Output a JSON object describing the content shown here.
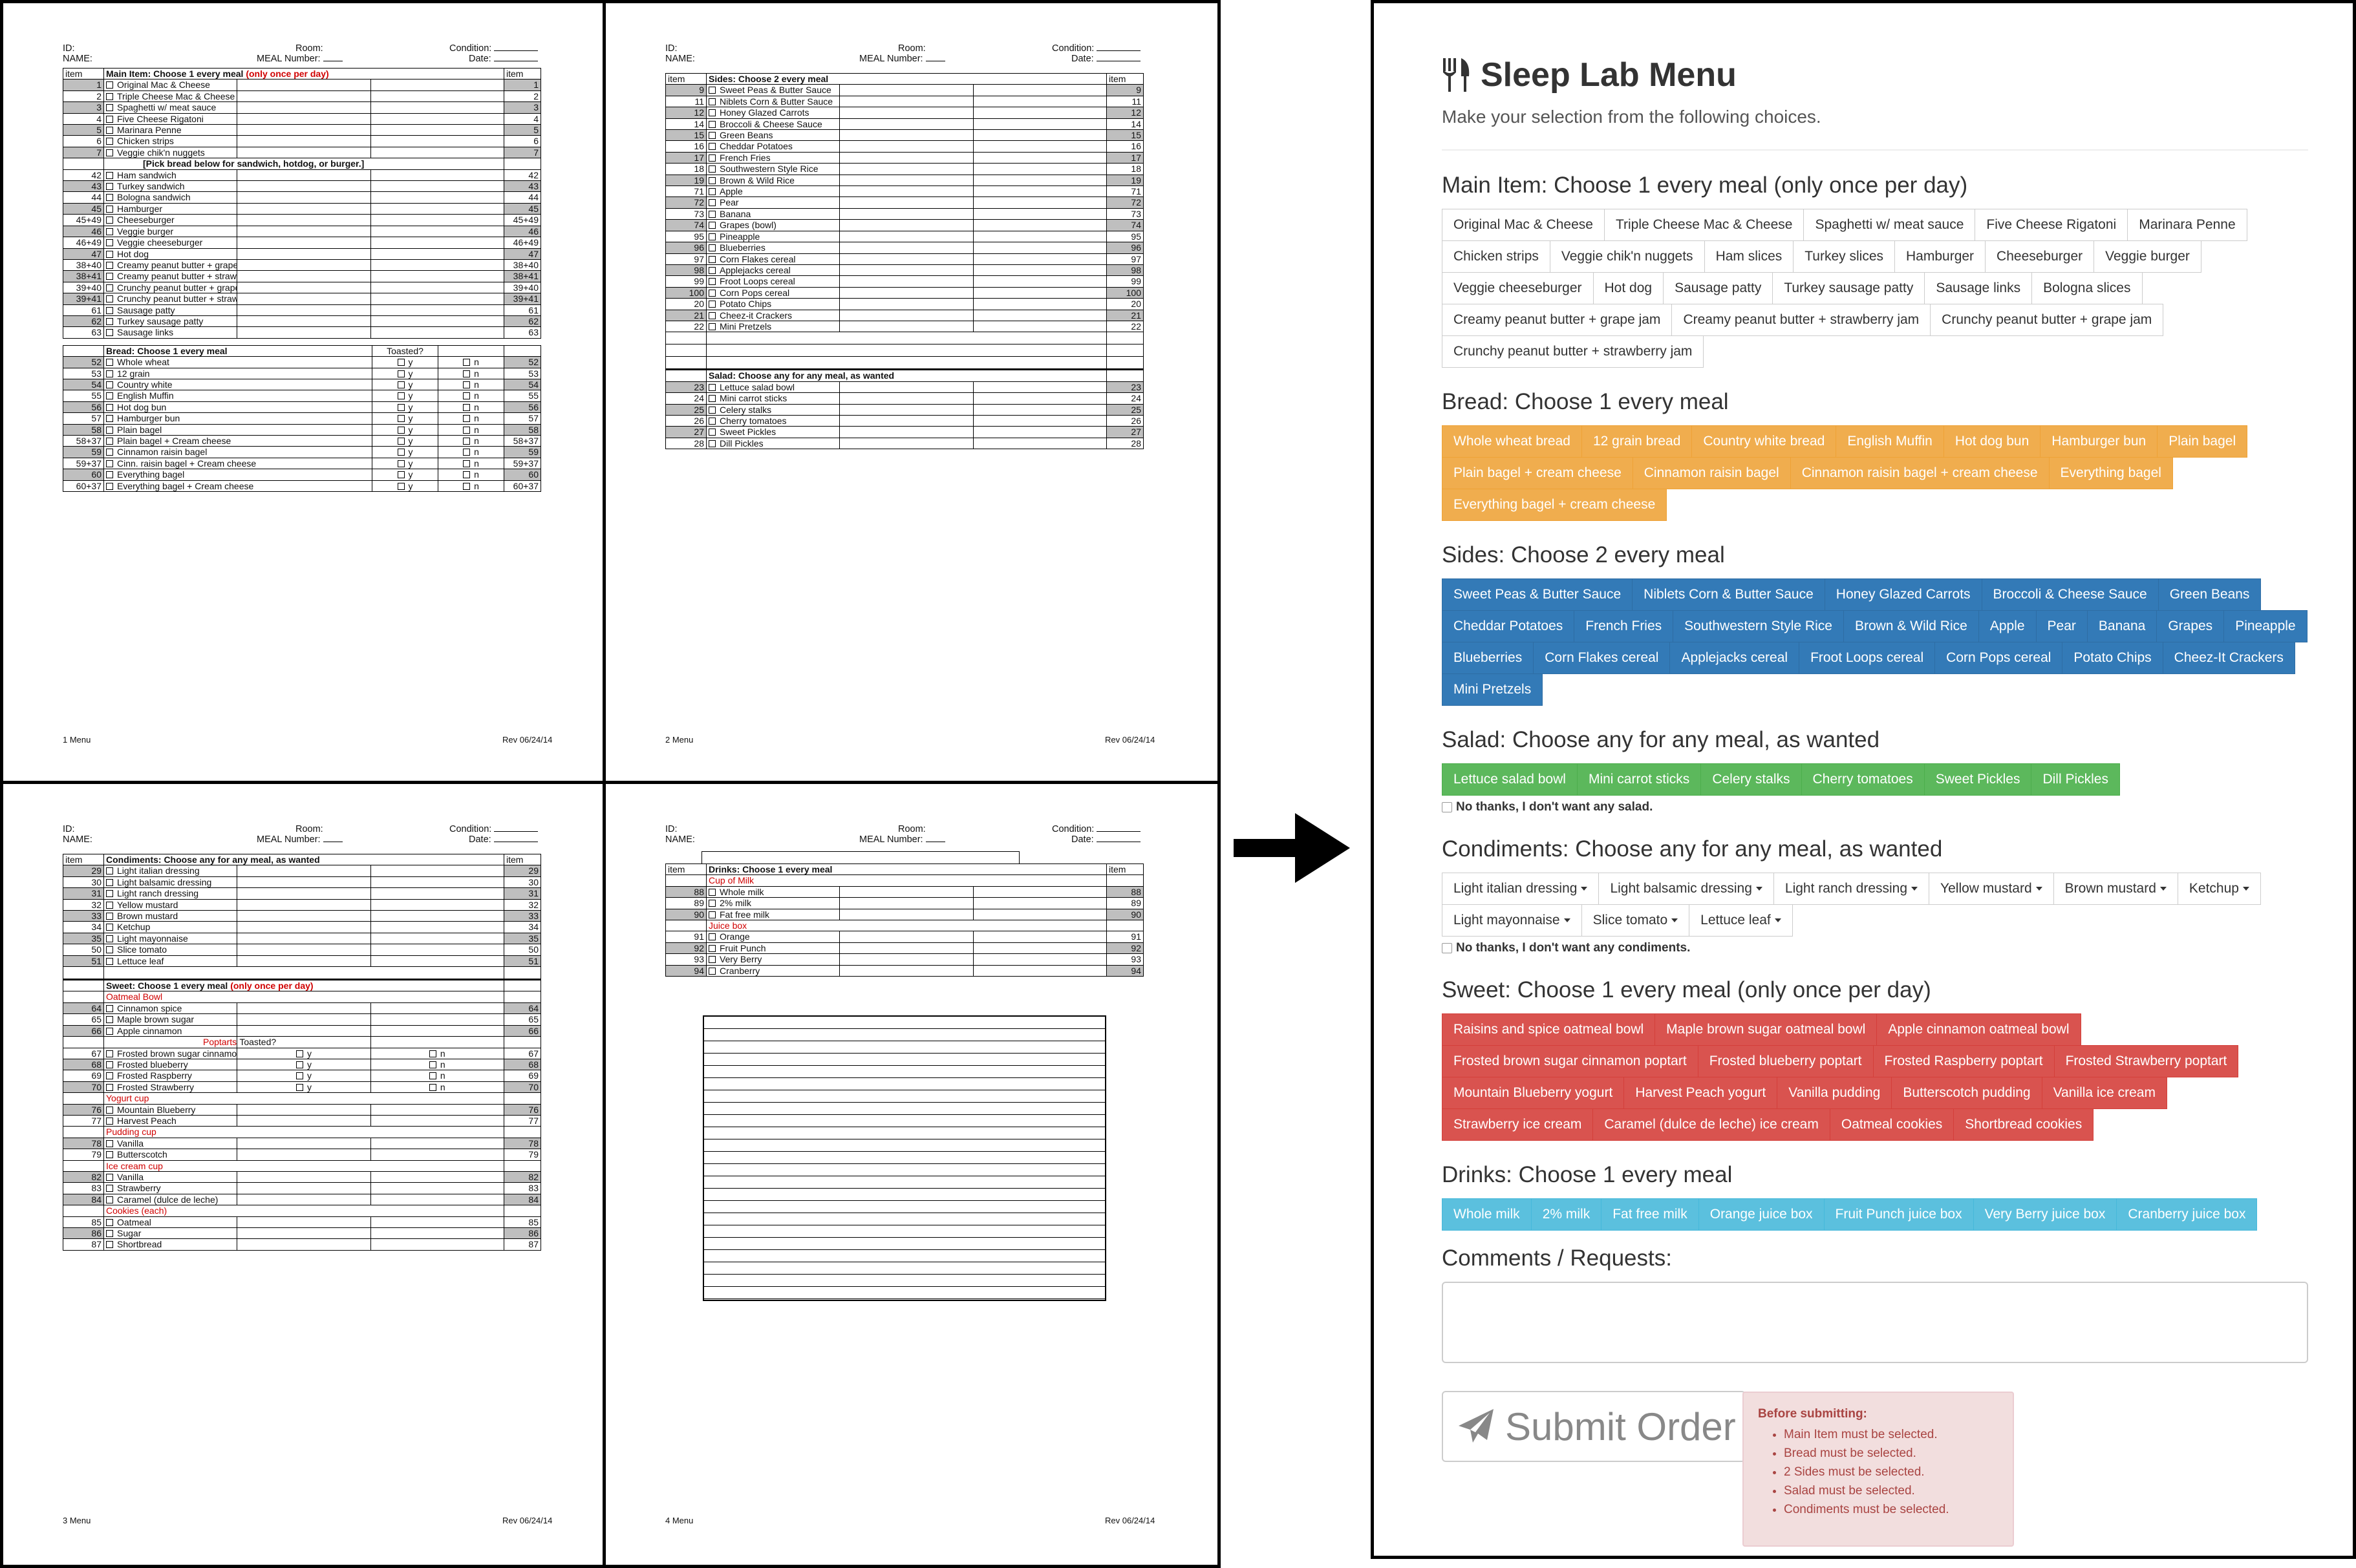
{
  "header": {
    "id_label": "ID:",
    "name_label": "NAME:",
    "room_label": "Room:",
    "meal_number_label": "MEAL Number:",
    "condition_label": "Condition:",
    "date_label": "Date:",
    "item_col": "item",
    "rev": "Rev 06/24/14"
  },
  "page1": {
    "footer": "1  Menu",
    "main_title": "Main Item:  Choose 1 every meal ",
    "main_title_red": "(only once per day)",
    "main_rows": [
      {
        "n": "1",
        "t": "Original Mac & Cheese",
        "r": "1",
        "g": true
      },
      {
        "n": "2",
        "t": "Triple Cheese Mac & Cheese",
        "r": "2",
        "g": false
      },
      {
        "n": "3",
        "t": "Spaghetti w/ meat sauce",
        "r": "3",
        "g": true
      },
      {
        "n": "4",
        "t": "Five Cheese Rigatoni",
        "r": "4",
        "g": false
      },
      {
        "n": "5",
        "t": "Marinara Penne",
        "r": "5",
        "g": true
      },
      {
        "n": "6",
        "t": "Chicken strips",
        "r": "6",
        "g": false
      },
      {
        "n": "7",
        "t": "Veggie chik'n nuggets",
        "r": "7",
        "g": true
      }
    ],
    "pick_note": "[Pick bread below for sandwich, hotdog, or burger.]",
    "main_rows2": [
      {
        "n": "42",
        "t": "Ham sandwich",
        "r": "42",
        "g": false
      },
      {
        "n": "43",
        "t": "Turkey sandwich",
        "r": "43",
        "g": true
      },
      {
        "n": "44",
        "t": "Bologna sandwich",
        "r": "44",
        "g": false
      },
      {
        "n": "45",
        "t": "Hamburger",
        "r": "45",
        "g": true
      },
      {
        "n": "45+49",
        "t": "Cheeseburger",
        "r": "45+49",
        "g": false
      },
      {
        "n": "46",
        "t": "Veggie burger",
        "r": "46",
        "g": true
      },
      {
        "n": "46+49",
        "t": "Veggie cheeseburger",
        "r": "46+49",
        "g": false
      },
      {
        "n": "47",
        "t": "Hot dog",
        "r": "47",
        "g": true
      },
      {
        "n": "38+40",
        "t": "Creamy peanut butter + grape jam sandwich",
        "r": "38+40",
        "g": false
      },
      {
        "n": "38+41",
        "t": "Creamy peanut butter + strawberry jam sandwich",
        "r": "38+41",
        "g": true
      },
      {
        "n": "39+40",
        "t": "Crunchy peanut butter + grape jam sandwich",
        "r": "39+40",
        "g": false
      },
      {
        "n": "39+41",
        "t": "Crunchy peanut butter + strawberry jam sandwich",
        "r": "39+41",
        "g": true
      },
      {
        "n": "61",
        "t": "Sausage patty",
        "r": "61",
        "g": false
      },
      {
        "n": "62",
        "t": "Turkey sausage patty",
        "r": "62",
        "g": true
      },
      {
        "n": "63",
        "t": "Sausage links",
        "r": "63",
        "g": false
      }
    ],
    "bread_title": "Bread:  Choose 1 every meal",
    "toasted_label": "Toasted?",
    "y_label": "y",
    "n_label": "n",
    "bread_rows": [
      {
        "n": "52",
        "t": "Whole wheat",
        "r": "52",
        "g": true
      },
      {
        "n": "53",
        "t": "12 grain",
        "r": "53",
        "g": false
      },
      {
        "n": "54",
        "t": "Country white",
        "r": "54",
        "g": true
      },
      {
        "n": "55",
        "t": "English Muffin",
        "r": "55",
        "g": false
      },
      {
        "n": "56",
        "t": "Hot dog bun",
        "r": "56",
        "g": true
      },
      {
        "n": "57",
        "t": "Hamburger bun",
        "r": "57",
        "g": false
      },
      {
        "n": "58",
        "t": "Plain bagel",
        "r": "58",
        "g": true
      },
      {
        "n": "58+37",
        "t": "Plain bagel + Cream cheese",
        "r": "58+37",
        "g": false
      },
      {
        "n": "59",
        "t": "Cinnamon raisin bagel",
        "r": "59",
        "g": true
      },
      {
        "n": "59+37",
        "t": "Cinn. raisin bagel + Cream cheese",
        "r": "59+37",
        "g": false
      },
      {
        "n": "60",
        "t": "Everything bagel",
        "r": "60",
        "g": true
      },
      {
        "n": "60+37",
        "t": "Everything bagel + Cream cheese",
        "r": "60+37",
        "g": false
      }
    ]
  },
  "page2": {
    "footer": "2  Menu",
    "sides_title": "Sides:  Choose 2 every meal",
    "sides_rows": [
      {
        "n": "9",
        "t": "Sweet Peas & Butter Sauce",
        "r": "9",
        "g": true
      },
      {
        "n": "11",
        "t": "Niblets Corn & Butter Sauce",
        "r": "11",
        "g": false
      },
      {
        "n": "12",
        "t": "Honey Glazed Carrots",
        "r": "12",
        "g": true
      },
      {
        "n": "14",
        "t": "Broccoli & Cheese Sauce",
        "r": "14",
        "g": false
      },
      {
        "n": "15",
        "t": "Green Beans",
        "r": "15",
        "g": true
      },
      {
        "n": "16",
        "t": "Cheddar Potatoes",
        "r": "16",
        "g": false
      },
      {
        "n": "17",
        "t": "French Fries",
        "r": "17",
        "g": true
      },
      {
        "n": "18",
        "t": "Southwestern Style Rice",
        "r": "18",
        "g": false
      },
      {
        "n": "19",
        "t": "Brown & Wild Rice",
        "r": "19",
        "g": true
      },
      {
        "n": "71",
        "t": "Apple",
        "r": "71",
        "g": false
      },
      {
        "n": "72",
        "t": "Pear",
        "r": "72",
        "g": true
      },
      {
        "n": "73",
        "t": "Banana",
        "r": "73",
        "g": false
      },
      {
        "n": "74",
        "t": "Grapes (bowl)",
        "r": "74",
        "g": true
      },
      {
        "n": "95",
        "t": "Pineapple",
        "r": "95",
        "g": false
      },
      {
        "n": "96",
        "t": "Blueberries",
        "r": "96",
        "g": true
      },
      {
        "n": "97",
        "t": "Corn Flakes cereal",
        "r": "97",
        "g": false
      },
      {
        "n": "98",
        "t": "Applejacks cereal",
        "r": "98",
        "g": true
      },
      {
        "n": "99",
        "t": "Froot Loops cereal",
        "r": "99",
        "g": false
      },
      {
        "n": "100",
        "t": "Corn Pops cereal",
        "r": "100",
        "g": true
      },
      {
        "n": "20",
        "t": "Potato Chips",
        "r": "20",
        "g": false
      },
      {
        "n": "21",
        "t": "Cheez-it Crackers",
        "r": "21",
        "g": true
      },
      {
        "n": "22",
        "t": "Mini Pretzels",
        "r": "22",
        "g": false
      }
    ],
    "salad_title": "Salad:  Choose any for any meal, as wanted",
    "salad_rows": [
      {
        "n": "23",
        "t": "Lettuce salad bowl",
        "r": "23",
        "g": true
      },
      {
        "n": "24",
        "t": "Mini carrot sticks",
        "r": "24",
        "g": false
      },
      {
        "n": "25",
        "t": "Celery stalks",
        "r": "25",
        "g": true
      },
      {
        "n": "26",
        "t": "Cherry tomatoes",
        "r": "26",
        "g": false
      },
      {
        "n": "27",
        "t": "Sweet Pickles",
        "r": "27",
        "g": true
      },
      {
        "n": "28",
        "t": "Dill Pickles",
        "r": "28",
        "g": false
      }
    ]
  },
  "page3": {
    "footer": "3  Menu",
    "cond_title": "Condiments:  Choose any for any meal, as wanted",
    "cond_rows": [
      {
        "n": "29",
        "t": "Light italian dressing",
        "r": "29",
        "g": true
      },
      {
        "n": "30",
        "t": "Light balsamic dressing",
        "r": "30",
        "g": false
      },
      {
        "n": "31",
        "t": "Light ranch dressing",
        "r": "31",
        "g": true
      },
      {
        "n": "32",
        "t": "Yellow mustard",
        "r": "32",
        "g": false
      },
      {
        "n": "33",
        "t": "Brown mustard",
        "r": "33",
        "g": true
      },
      {
        "n": "34",
        "t": "Ketchup",
        "r": "34",
        "g": false
      },
      {
        "n": "35",
        "t": "Light mayonnaise",
        "r": "35",
        "g": true
      },
      {
        "n": "50",
        "t": "Slice tomato",
        "r": "50",
        "g": false
      },
      {
        "n": "51",
        "t": "Lettuce leaf",
        "r": "51",
        "g": true
      }
    ],
    "sweet_title": "Sweet:   Choose 1 every meal ",
    "sweet_title_red": "(only once per day)",
    "oatmeal_label": "Oatmeal Bowl",
    "oatmeal_rows": [
      {
        "n": "64",
        "t": "Cinnamon spice",
        "r": "64",
        "g": true
      },
      {
        "n": "65",
        "t": "Maple brown sugar",
        "r": "65",
        "g": false
      },
      {
        "n": "66",
        "t": "Apple cinnamon",
        "r": "66",
        "g": true
      }
    ],
    "poptarts_label": "Poptarts (each)",
    "poptart_rows": [
      {
        "n": "67",
        "t": "Frosted brown sugar cinnamon",
        "r": "67",
        "g": false
      },
      {
        "n": "68",
        "t": "Frosted blueberry",
        "r": "68",
        "g": true
      },
      {
        "n": "69",
        "t": "Frosted Raspberry",
        "r": "69",
        "g": false
      },
      {
        "n": "70",
        "t": "Frosted Strawberry",
        "r": "70",
        "g": true
      }
    ],
    "yogurt_label": "Yogurt cup",
    "yogurt_rows": [
      {
        "n": "76",
        "t": "Mountain Blueberry",
        "r": "76",
        "g": true
      },
      {
        "n": "77",
        "t": "Harvest Peach",
        "r": "77",
        "g": false
      }
    ],
    "pudding_label": "Pudding cup",
    "pudding_rows": [
      {
        "n": "78",
        "t": "Vanilla",
        "r": "78",
        "g": true
      },
      {
        "n": "79",
        "t": "Butterscotch",
        "r": "79",
        "g": false
      }
    ],
    "icecream_label": "Ice cream cup",
    "icecream_rows": [
      {
        "n": "82",
        "t": "Vanilla",
        "r": "82",
        "g": true
      },
      {
        "n": "83",
        "t": "Strawberry",
        "r": "83",
        "g": false
      },
      {
        "n": "84",
        "t": "Caramel (dulce de leche)",
        "r": "84",
        "g": true
      }
    ],
    "cookies_label": "Cookies (each)",
    "cookie_rows": [
      {
        "n": "85",
        "t": "Oatmeal",
        "r": "85",
        "g": false
      },
      {
        "n": "86",
        "t": "Sugar",
        "r": "86",
        "g": true
      },
      {
        "n": "87",
        "t": "Shortbread",
        "r": "87",
        "g": false
      }
    ]
  },
  "page4": {
    "footer": "4  Menu",
    "drinks_title": "Drinks:  Choose 1 every meal",
    "milk_label": "Cup of Milk",
    "milk_rows": [
      {
        "n": "88",
        "t": "Whole milk",
        "r": "88",
        "g": true
      },
      {
        "n": "89",
        "t": "2% milk",
        "r": "89",
        "g": false
      },
      {
        "n": "90",
        "t": "Fat free milk",
        "r": "90",
        "g": true
      }
    ],
    "juice_label": "Juice box",
    "juice_rows": [
      {
        "n": "91",
        "t": "Orange",
        "r": "91",
        "g": false
      },
      {
        "n": "92",
        "t": "Fruit Punch",
        "r": "92",
        "g": true
      },
      {
        "n": "93",
        "t": "Very Berry",
        "r": "93",
        "g": false
      },
      {
        "n": "94",
        "t": "Cranberry",
        "r": "94",
        "g": true
      }
    ]
  },
  "web": {
    "title": "Sleep Lab Menu",
    "subtitle": "Make your selection from the following choices.",
    "main_heading": "Main Item: Choose 1 every meal (only once per day)",
    "main_items": [
      "Original Mac & Cheese",
      "Triple Cheese Mac & Cheese",
      "Spaghetti w/ meat sauce",
      "Five Cheese Rigatoni",
      "Marinara Penne",
      "Chicken strips",
      "Veggie chik'n nuggets",
      "Ham slices",
      "Turkey slices",
      "Hamburger",
      "Cheeseburger",
      "Veggie burger",
      "Veggie cheeseburger",
      "Hot dog",
      "Sausage patty",
      "Turkey sausage patty",
      "Sausage links",
      "Bologna slices",
      "Creamy peanut butter + grape jam",
      "Creamy peanut butter + strawberry jam",
      "Crunchy peanut butter + grape jam",
      "Crunchy peanut butter + strawberry jam"
    ],
    "bread_heading": "Bread: Choose 1 every meal",
    "bread_items": [
      "Whole wheat bread",
      "12 grain bread",
      "Country white bread",
      "English Muffin",
      "Hot dog bun",
      "Hamburger bun",
      "Plain bagel",
      "Plain bagel + cream cheese",
      "Cinnamon raisin bagel",
      "Cinnamon raisin bagel + cream cheese",
      "Everything bagel",
      "Everything bagel + cream cheese"
    ],
    "sides_heading": "Sides: Choose 2 every meal",
    "sides_items": [
      "Sweet Peas & Butter Sauce",
      "Niblets Corn & Butter Sauce",
      "Honey Glazed Carrots",
      "Broccoli & Cheese Sauce",
      "Green Beans",
      "Cheddar Potatoes",
      "French Fries",
      "Southwestern Style Rice",
      "Brown & Wild Rice",
      "Apple",
      "Pear",
      "Banana",
      "Grapes",
      "Pineapple",
      "Blueberries",
      "Corn Flakes cereal",
      "Applejacks cereal",
      "Froot Loops cereal",
      "Corn Pops cereal",
      "Potato Chips",
      "Cheez-It Crackers",
      "Mini Pretzels"
    ],
    "salad_heading": "Salad: Choose any for any meal, as wanted",
    "salad_items": [
      "Lettuce salad bowl",
      "Mini carrot sticks",
      "Celery stalks",
      "Cherry tomatoes",
      "Sweet Pickles",
      "Dill Pickles"
    ],
    "salad_nothanks": "No thanks, I don't want any salad.",
    "cond_heading": "Condiments: Choose any for any meal, as wanted",
    "cond_items": [
      "Light italian dressing",
      "Light balsamic dressing",
      "Light ranch dressing",
      "Yellow mustard",
      "Brown mustard",
      "Ketchup",
      "Light mayonnaise",
      "Slice tomato",
      "Lettuce leaf"
    ],
    "cond_nothanks": "No thanks, I don't want any condiments.",
    "sweet_heading": "Sweet: Choose 1 every meal (only once per day)",
    "sweet_items": [
      "Raisins and spice oatmeal bowl",
      "Maple brown sugar oatmeal bowl",
      "Apple cinnamon oatmeal bowl",
      "Frosted brown sugar cinnamon poptart",
      "Frosted blueberry poptart",
      "Frosted Raspberry poptart",
      "Frosted Strawberry poptart",
      "Mountain Blueberry yogurt",
      "Harvest Peach yogurt",
      "Vanilla pudding",
      "Butterscotch pudding",
      "Vanilla ice cream",
      "Strawberry ice cream",
      "Caramel (dulce de leche) ice cream",
      "Oatmeal cookies",
      "Shortbread cookies"
    ],
    "drinks_heading": "Drinks: Choose 1 every meal",
    "drinks_items": [
      "Whole milk",
      "2% milk",
      "Fat free milk",
      "Orange juice box",
      "Fruit Punch juice box",
      "Very Berry juice box",
      "Cranberry juice box"
    ],
    "comments_heading": "Comments / Requests:",
    "submit_label": "Submit Order",
    "errors_title": "Before submitting:",
    "errors": [
      "Main Item must be selected.",
      "Bread must be selected.",
      "2 Sides must be selected.",
      "Salad must be selected.",
      "Condiments must be selected."
    ],
    "colors": {
      "bread": "#f0ad4e",
      "sides": "#337ab7",
      "salad": "#5cb85c",
      "sweet": "#d9534f",
      "drinks": "#5bc0de"
    }
  }
}
